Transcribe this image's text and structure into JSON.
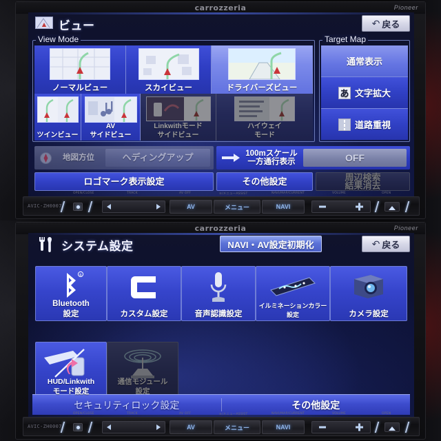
{
  "device": {
    "brand_center": "carrozzeria",
    "brand_right": "Pioneer",
    "model": "AVIC-ZH0007"
  },
  "faceplate": {
    "tiny_labels": [
      "OPEN/CLOSE",
      "TRACK",
      "AV OFF",
      "≡/メニューASSIST",
      "NAVI/MAP/CURRENT",
      "VOLUME",
      "OPEN"
    ],
    "keys": [
      {
        "name": "av-key",
        "label": "AV"
      },
      {
        "name": "menu-key",
        "label": "メニュー"
      },
      {
        "name": "navi-key",
        "label": "NAVI"
      }
    ]
  },
  "colors": {
    "tile_blue": "#2f3ec4",
    "tile_selected": "#7b8aea",
    "accent_white": "#ffffff",
    "screen_bg": "#0c1030",
    "back_button_bg": "#d7d8e8",
    "reset_button_bg": "#5c73d8"
  },
  "view_screen": {
    "header": {
      "icon": "map-view-icon",
      "title": "ビュー",
      "back_label": "戻る",
      "back_icon": "back-arrow-icon"
    },
    "view_mode": {
      "group_label": "View Mode",
      "tiles": [
        {
          "name": "normal-view",
          "label": "ノーマルビュー",
          "thumb": "normal-map-thumb",
          "state": "enabled"
        },
        {
          "name": "sky-view",
          "label": "スカイビュー",
          "thumb": "sky-map-thumb",
          "state": "enabled"
        },
        {
          "name": "drivers-view",
          "label": "ドライバーズビュー",
          "thumb": "drivers-map-thumb",
          "state": "selected"
        },
        {
          "name": "twin-view",
          "label": "ツインビュー",
          "thumb": "twin-map-thumb",
          "state": "enabled"
        },
        {
          "name": "av-side-view",
          "label_line1": "AV",
          "label_line2": "サイドビュー",
          "thumb": "av-side-thumb",
          "state": "enabled"
        },
        {
          "name": "linkwith-side-view",
          "label_line1": "Linkwithモード",
          "label_line2": "サイドビュー",
          "thumb": "linkwith-thumb",
          "state": "disabled"
        },
        {
          "name": "highway-mode",
          "label_line1": "ハイウェイ",
          "label_line2": "モード",
          "thumb": "highway-thumb",
          "state": "disabled"
        }
      ]
    },
    "target_map": {
      "group_label": "Target Map",
      "items": [
        {
          "name": "normal-display",
          "label": "通常表示",
          "icon": null,
          "state": "selected"
        },
        {
          "name": "text-enlarge",
          "label": "文字拡大",
          "icon": "hiragana-a-icon",
          "icon_glyph": "あ",
          "state": "enabled"
        },
        {
          "name": "road-emphasis",
          "label": "道路重視",
          "icon": "road-lane-icon",
          "state": "enabled"
        }
      ]
    },
    "option_row": {
      "map_orientation": {
        "name": "map-orientation",
        "icon": "compass-icon",
        "label": "地図方位",
        "value": "ヘディングアップ",
        "state": "disabled"
      },
      "one_way": {
        "name": "one-way-display",
        "icon": "arrow-right-icon",
        "label_line1": "100mスケール",
        "label_line2": "一方通行表示",
        "value": "OFF",
        "state": "enabled"
      }
    },
    "bottom_buttons": [
      {
        "name": "logo-mark-display-setting",
        "label": "ロゴマーク表示設定",
        "state": "enabled"
      },
      {
        "name": "other-settings",
        "label": "その他設定",
        "state": "enabled"
      },
      {
        "name": "clear-nearby-search-results",
        "label_line1": "周辺検索",
        "label_line2": "結果消去",
        "state": "disabled"
      }
    ]
  },
  "system_screen": {
    "header": {
      "icon": "wrench-screwdriver-icon",
      "title": "システム設定",
      "reset_label": "NAVI・AV設定初期化",
      "back_label": "戻る",
      "back_icon": "back-arrow-icon"
    },
    "tiles": [
      {
        "name": "bluetooth-setting",
        "label_line1": "Bluetooth",
        "label_line2": "設定",
        "icon": "bluetooth-icon",
        "state": "enabled"
      },
      {
        "name": "custom-setting",
        "label_line1": "カスタム設定",
        "label_line2": "",
        "icon": "custom-c-icon",
        "state": "enabled"
      },
      {
        "name": "voice-recognition-setting",
        "label_line1": "音声認識設定",
        "label_line2": "",
        "icon": "microphone-icon",
        "state": "enabled"
      },
      {
        "name": "illumination-color-setting",
        "label_line1": "イルミネーションカラー",
        "label_line2": "設定",
        "icon": "illumination-bar-icon",
        "state": "enabled"
      },
      {
        "name": "camera-setting",
        "label_line1": "カメラ設定",
        "label_line2": "",
        "icon": "camera-icon",
        "state": "enabled"
      },
      {
        "name": "hud-linkwith-mode-setting",
        "label_line1": "HUD/Linkwith",
        "label_line2": "モード設定",
        "icon": "hud-phone-icon",
        "state": "enabled"
      },
      {
        "name": "communication-module-setting",
        "label_line1": "通信モジュール",
        "label_line2": "設定",
        "icon": "antenna-signal-icon",
        "state": "disabled"
      }
    ],
    "bottom_bar": [
      {
        "name": "security-lock-setting",
        "label": "セキュリティロック設定",
        "state": "dim"
      },
      {
        "name": "other-settings",
        "label": "その他設定",
        "state": "enabled"
      }
    ]
  }
}
